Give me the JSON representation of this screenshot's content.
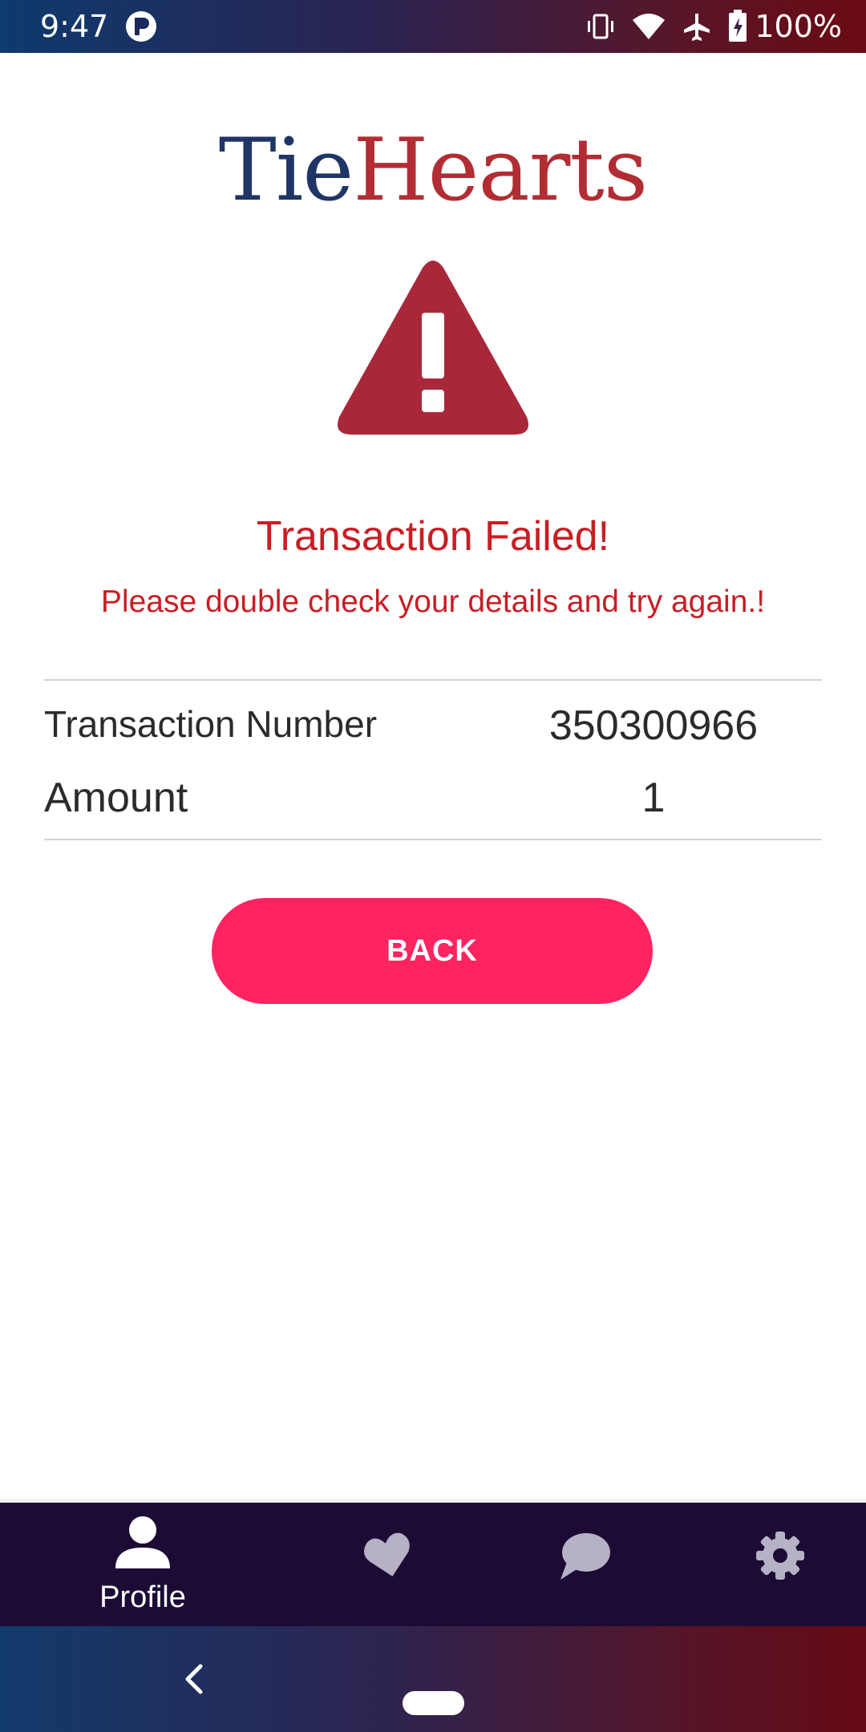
{
  "status_bar": {
    "time": "9:47",
    "battery_percent": "100%",
    "icons": [
      "app-notification-icon",
      "vibrate-icon",
      "wifi-icon",
      "airplane-icon",
      "battery-charging-icon"
    ]
  },
  "logo": {
    "part1": "Tie",
    "part2": "Hearts",
    "part1_color": "#1f3566",
    "part2_color": "#b22d33"
  },
  "alert": {
    "icon": "warning-icon",
    "title": "Transaction Failed!",
    "message": "Please double check your details and try again.!",
    "color": "#c81e24"
  },
  "details": {
    "rows": [
      {
        "label": "Transaction Number",
        "value": "350300966"
      },
      {
        "label": "Amount",
        "value": "1"
      }
    ]
  },
  "actions": {
    "back_label": "BACK",
    "back_color": "#ff2360"
  },
  "bottom_nav": {
    "items": [
      {
        "label": "Profile",
        "icon": "profile-icon",
        "active": true
      },
      {
        "label": "",
        "icon": "heart-icon",
        "active": false
      },
      {
        "label": "",
        "icon": "chat-icon",
        "active": false
      },
      {
        "label": "",
        "icon": "settings-icon",
        "active": false
      }
    ],
    "background": "#1c0c35"
  },
  "system_nav": {
    "icons": [
      "system-back-icon",
      "system-home-icon"
    ]
  }
}
